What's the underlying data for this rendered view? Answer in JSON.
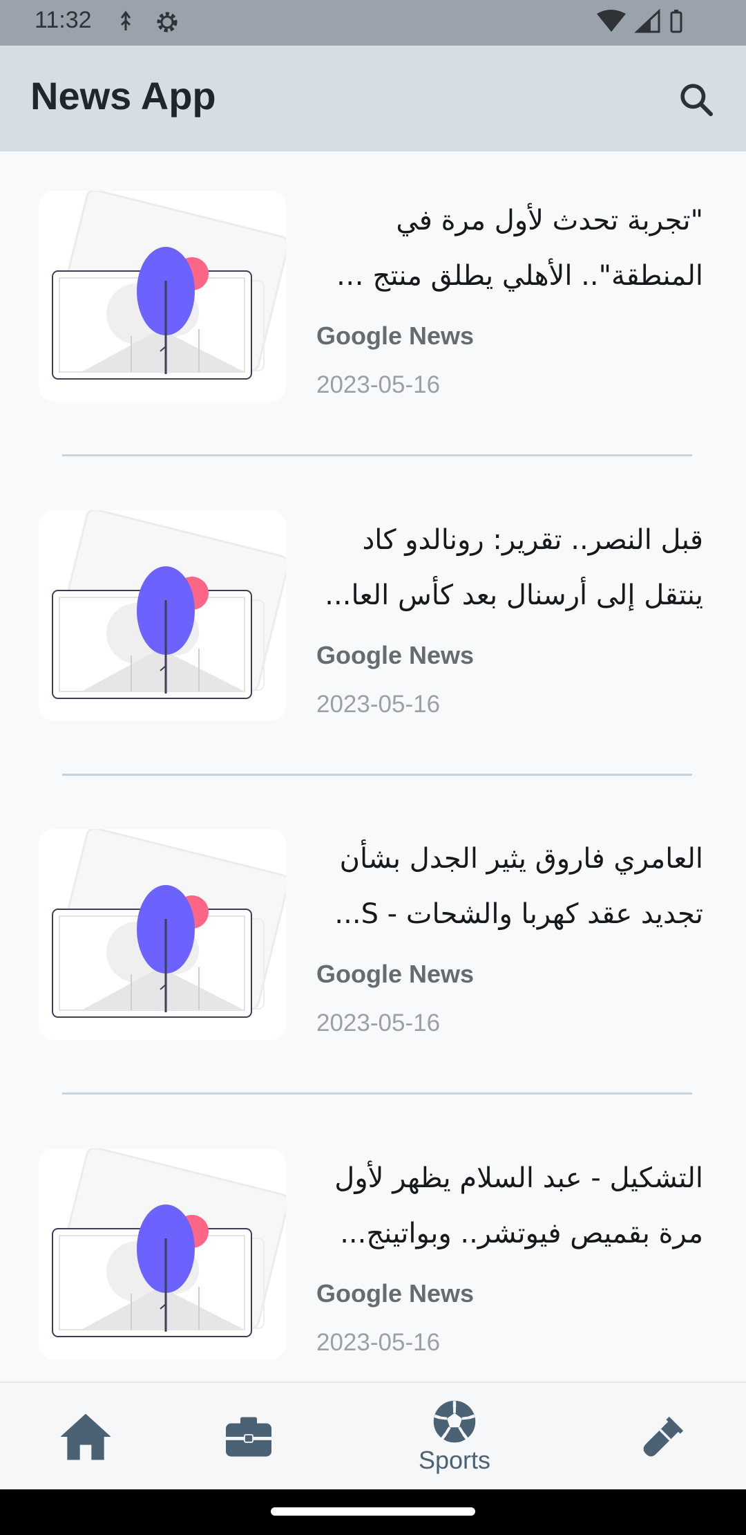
{
  "status": {
    "time": "11:32"
  },
  "app_bar": {
    "title": "News App",
    "search_icon": "search-icon"
  },
  "articles": [
    {
      "title_lines": [
        "\"تجربة تحدث لأول مرة في",
        "المنطقة\".. الأهلي يطلق منتج ف..."
      ],
      "source": "Google News",
      "date": "2023-05-16"
    },
    {
      "title_lines": [
        "قبل النصر.. تقرير: رونالدو كاد",
        "ينتقل إلى أرسنال بعد كأس العا..."
      ],
      "source": "Google News",
      "date": "2023-05-16"
    },
    {
      "title_lines": [
        "العامري فاروق يثير الجدل بشأن",
        "تجديد عقد كهربا والشحات - S..."
      ],
      "source": "Google News",
      "date": "2023-05-16"
    },
    {
      "title_lines": [
        "التشكيل - عبد السلام يظهر لأول",
        "مرة بقميص فيوتشر.. وبواتينج..."
      ],
      "source": "Google News",
      "date": "2023-05-16"
    }
  ],
  "bottom_nav": {
    "items": [
      {
        "icon": "home-icon",
        "label": ""
      },
      {
        "icon": "briefcase-icon",
        "label": ""
      },
      {
        "icon": "soccer-ball-icon",
        "label": "Sports"
      },
      {
        "icon": "test-tube-icon",
        "label": ""
      }
    ]
  },
  "colors": {
    "app_bar_bg": "#d6dee4",
    "status_bar_bg": "#9aa3ab",
    "nav_icon": "#4a6274",
    "tree_purple": "#6c63ff",
    "accent_pink": "#ff6584"
  }
}
